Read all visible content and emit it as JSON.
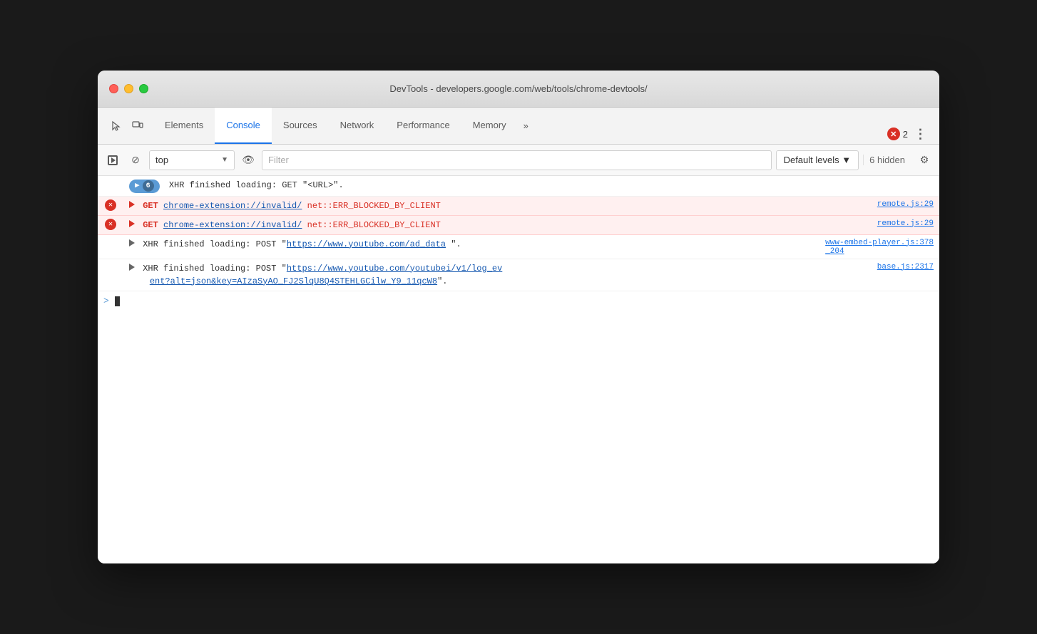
{
  "window": {
    "title": "DevTools - developers.google.com/web/tools/chrome-devtools/"
  },
  "tabs": {
    "items": [
      {
        "id": "elements",
        "label": "Elements",
        "active": false
      },
      {
        "id": "console",
        "label": "Console",
        "active": true
      },
      {
        "id": "sources",
        "label": "Sources",
        "active": false
      },
      {
        "id": "network",
        "label": "Network",
        "active": false
      },
      {
        "id": "performance",
        "label": "Performance",
        "active": false
      },
      {
        "id": "memory",
        "label": "Memory",
        "active": false
      }
    ],
    "more_label": "»",
    "error_count": "2",
    "more_options_label": "⋮"
  },
  "toolbar": {
    "context_value": "top",
    "filter_placeholder": "Filter",
    "levels_label": "Default levels ▼",
    "hidden_label": "6 hidden"
  },
  "console_entries": [
    {
      "type": "info",
      "badge": true,
      "badge_text": "6",
      "message": "XHR finished loading: GET \"<URL>\".",
      "source": null
    },
    {
      "type": "error",
      "message_parts": [
        "GET",
        " ",
        "chrome-extension://invalid/",
        " ",
        "net::ERR_BLOCKED_BY_CLIENT"
      ],
      "source": "remote.js:29"
    },
    {
      "type": "error",
      "message_parts": [
        "GET",
        " ",
        "chrome-extension://invalid/",
        " ",
        "net::ERR_BLOCKED_BY_CLIENT"
      ],
      "source": "remote.js:29"
    },
    {
      "type": "info",
      "has_triangle": true,
      "message": "XHR finished loading: POST \"",
      "url": "https://www.youtube.com/ad_data",
      "message2": " ",
      "source": "www-embed-player.js:378_204",
      "source_display": "www-embed-player.js:378\n_204",
      "message_end": "\"."
    },
    {
      "type": "info",
      "has_triangle": true,
      "message": "XHR finished loading: POST \"",
      "url": "https://www.youtube.com/youtubei/v1/log_ev",
      "url2": "ent?alt=json&key=AIzaSyAO_FJ2SlqU8Q4STEHLGCilw_Y9_11qcW8",
      "source_display": "base.js:2317",
      "message_end": "\"."
    }
  ],
  "prompt": {
    "arrow": ">"
  },
  "colors": {
    "active_tab": "#1a73e8",
    "error_red": "#d93025",
    "link_blue": "#1558b0",
    "xhr_badge_bg": "#5b9bd5"
  }
}
